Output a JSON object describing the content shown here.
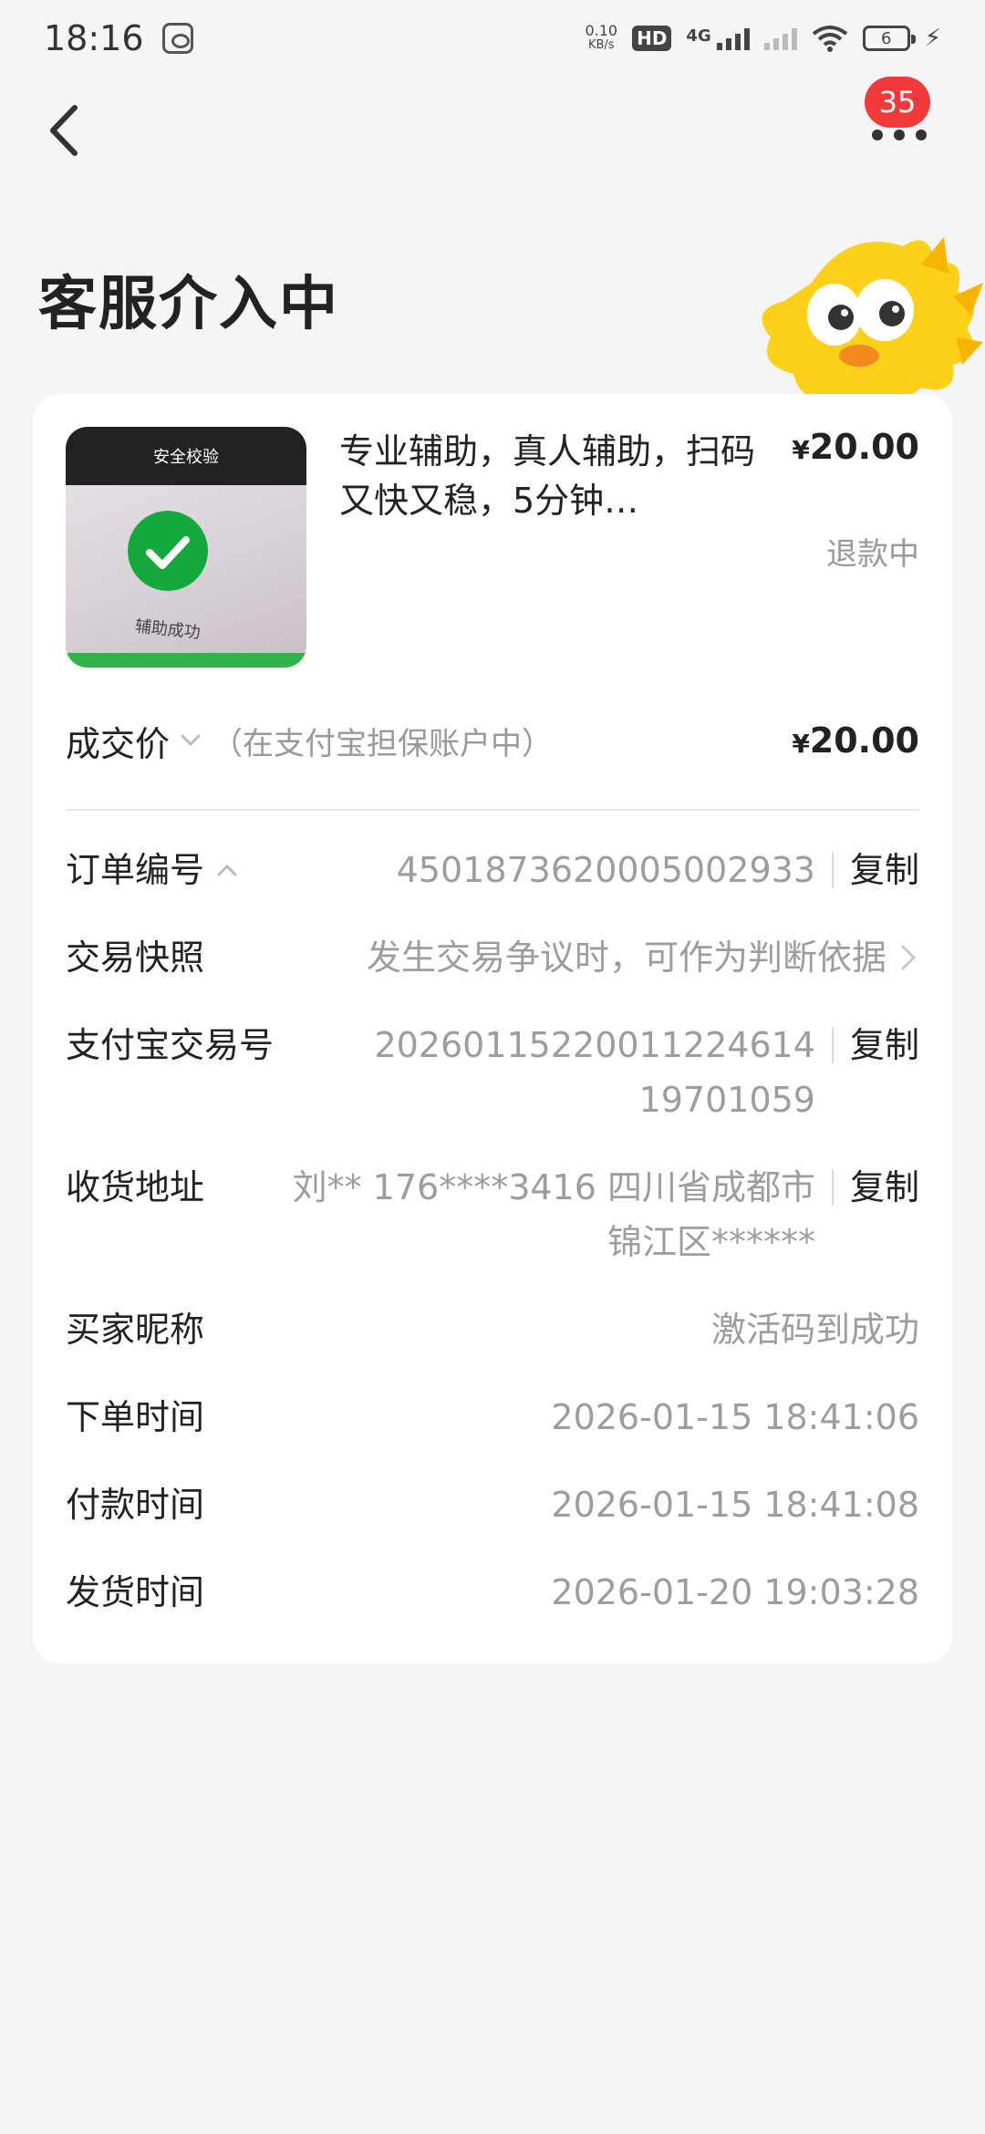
{
  "status_bar": {
    "time": "18:16",
    "net_speed_value": "0.10",
    "net_speed_unit": "KB/s",
    "hd": "HD",
    "network": "4G",
    "battery": "6"
  },
  "header": {
    "badge_count": "35",
    "title": "客服介入中"
  },
  "product": {
    "thumb_top_text": "安全校验",
    "thumb_caption": "辅助成功",
    "title": "专业辅助，真人辅助，扫码又快又稳，5分钟…",
    "price_symbol": "¥",
    "price": "20.00",
    "status": "退款中"
  },
  "deal": {
    "label": "成交价",
    "note": "（在支付宝担保账户中）",
    "price_symbol": "¥",
    "price": "20.00"
  },
  "details": {
    "order_no_label": "订单编号",
    "order_no": "4501873620005002933",
    "snapshot_label": "交易快照",
    "snapshot_value": "发生交易争议时，可作为判断依据",
    "alipay_no_label": "支付宝交易号",
    "alipay_no": "2026011522001122461419701059",
    "address_label": "收货地址",
    "address": "刘** 176****3416 四川省成都市锦江区******",
    "buyer_label": "买家昵称",
    "buyer": "激活码到成功",
    "order_time_label": "下单时间",
    "order_time": "2026-01-15 18:41:06",
    "pay_time_label": "付款时间",
    "pay_time": "2026-01-15 18:41:08",
    "ship_time_label": "发货时间",
    "ship_time": "2026-01-20 19:03:28",
    "copy_label": "复制"
  }
}
